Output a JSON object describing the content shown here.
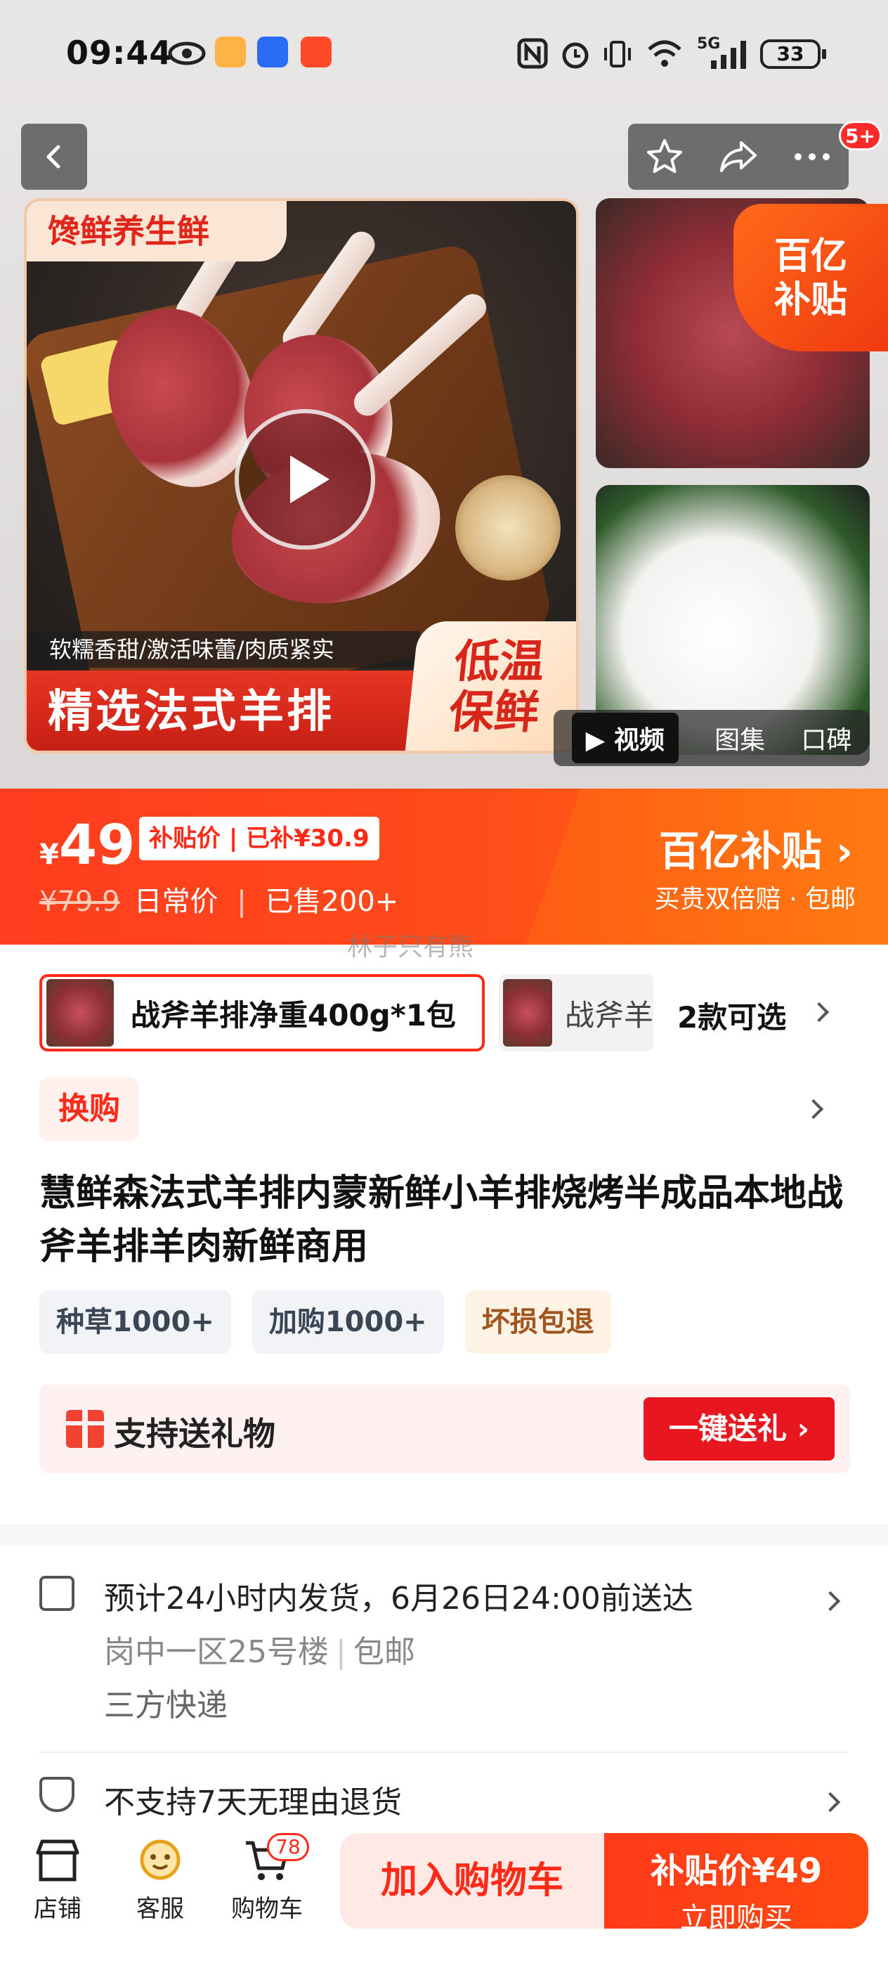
{
  "status_bar": {
    "time": "09:44",
    "battery": "33",
    "signal": "5G"
  },
  "nav": {
    "badge": "5+"
  },
  "gallery": {
    "tag_top": "馋鲜养生鲜",
    "sub_text": "软糯香甜/激活味蕾/肉质紧实",
    "banner_text": "精选法式羊排",
    "badge_text_1": "低温",
    "badge_text_2": "保鲜",
    "yi_badge_1": "百亿",
    "yi_badge_2": "补贴",
    "tabs": [
      "视频",
      "图集",
      "口碑"
    ]
  },
  "price": {
    "symbol": "¥",
    "current": "49",
    "chip": "补贴价 | 已补¥30.9",
    "old": "¥79.9",
    "old_label": "日常价",
    "sold": "已售200+",
    "program_title": "百亿补贴 ›",
    "program_sub": "买贵双倍赔 · 包邮"
  },
  "watermark": "林子只有熊",
  "sku": {
    "selected": "战斧羊排净重400g*1包",
    "other": "战斧羊",
    "count": "2款可选"
  },
  "huangou": "换购",
  "product_title": "慧鲜森法式羊排内蒙新鲜小羊排烧烤半成品本地战斧羊排羊肉新鲜商用",
  "tags": [
    "种草1000+",
    "加购1000+",
    "坏损包退"
  ],
  "gift": {
    "label": "支持送礼物",
    "button": "一键送礼 ›"
  },
  "delivery": {
    "line1": "预计24小时内发货，6月26日24:00前送达",
    "address": "岗中一区25号楼",
    "shipping": "包邮",
    "courier": "三方快递",
    "return_policy": "不支持7天无理由退货"
  },
  "bottom_bar": {
    "shop": "店铺",
    "service": "客服",
    "cart": "购物车",
    "cart_count": "78",
    "add_to_cart": "加入购物车",
    "buy_price": "补贴价¥49",
    "buy_now": "立即购买"
  },
  "colors": {
    "accent": "#ff2a17",
    "price_bar": "#ff4a1a",
    "buy_button": "#ff3a1a"
  }
}
